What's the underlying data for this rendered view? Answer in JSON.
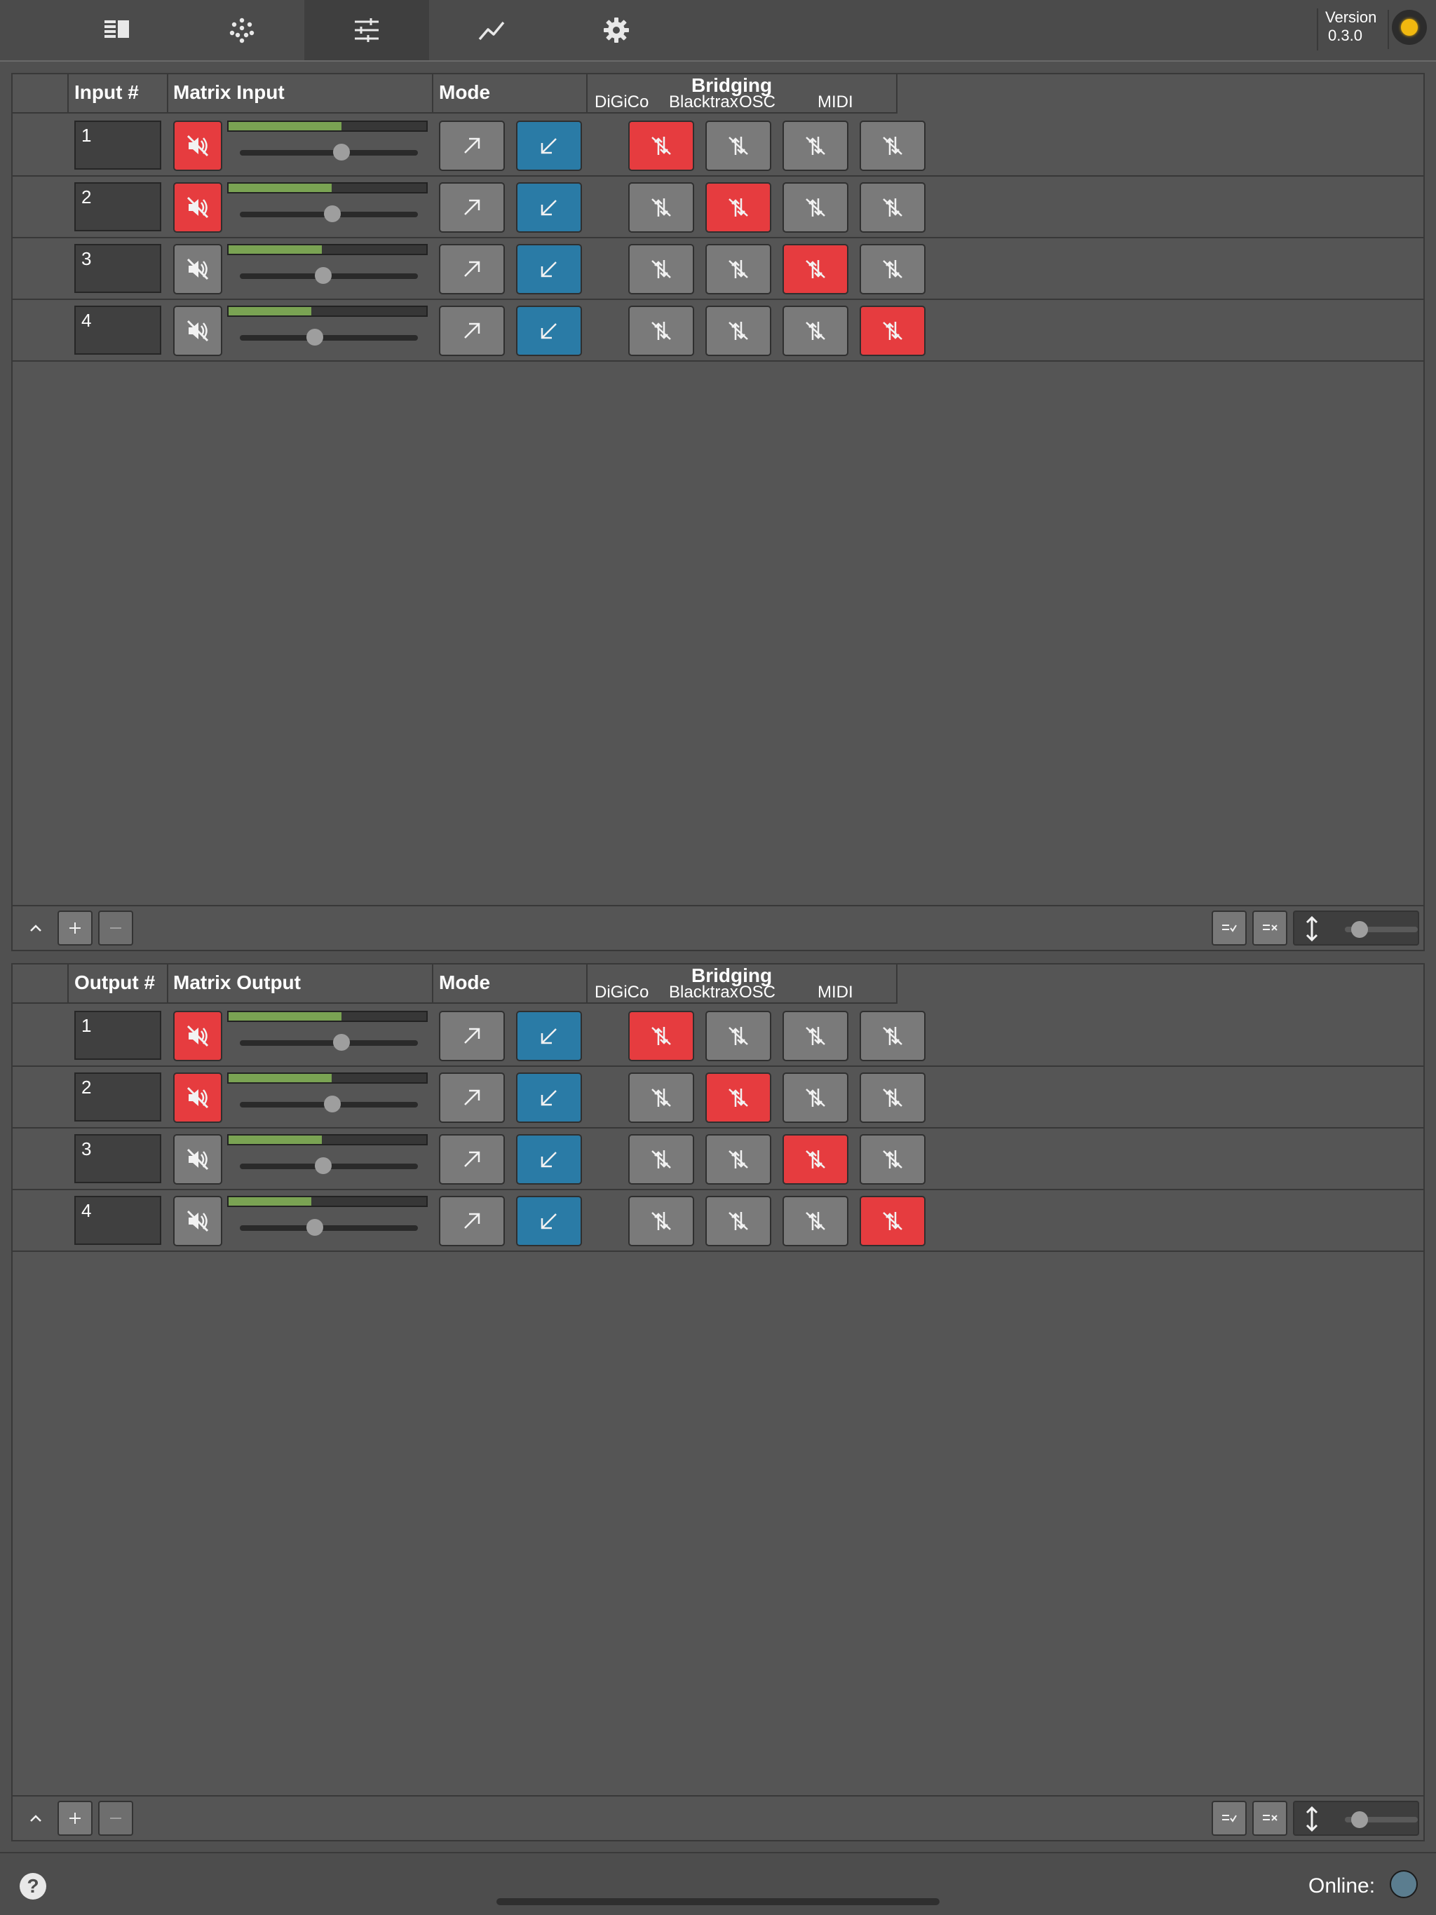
{
  "version": {
    "label": "Version",
    "number": "0.3.0"
  },
  "tabs": [
    {
      "name": "tab-sound-objects",
      "icon": "table-list-icon",
      "active": false
    },
    {
      "name": "tab-multislider",
      "icon": "dots-pattern-icon",
      "active": false
    },
    {
      "name": "tab-matrix-io",
      "icon": "sliders-icon",
      "active": true
    },
    {
      "name": "tab-statistics",
      "icon": "line-graph-icon",
      "active": false
    },
    {
      "name": "tab-settings",
      "icon": "gear-icon",
      "active": false
    }
  ],
  "bridging_labels": [
    "DiGiCo",
    "Blacktrax",
    "OSC",
    "MIDI"
  ],
  "panels": [
    {
      "id": "inputs",
      "num_header": "Input #",
      "name_header": "Matrix Input",
      "mode_header": "Mode",
      "bridging_title": "Bridging",
      "rows": [
        {
          "num": "1",
          "muted": true,
          "level": 0.57,
          "gain": 0.57,
          "bridging": [
            true,
            false,
            false,
            false
          ]
        },
        {
          "num": "2",
          "muted": true,
          "level": 0.52,
          "gain": 0.52,
          "bridging": [
            false,
            true,
            false,
            false
          ]
        },
        {
          "num": "3",
          "muted": false,
          "level": 0.47,
          "gain": 0.47,
          "bridging": [
            false,
            false,
            true,
            false
          ]
        },
        {
          "num": "4",
          "muted": false,
          "level": 0.42,
          "gain": 0.42,
          "bridging": [
            false,
            false,
            false,
            true
          ]
        }
      ],
      "footer": {
        "add_label": "+",
        "remove_label": "−",
        "row_height": 0.2
      }
    },
    {
      "id": "outputs",
      "num_header": "Output #",
      "name_header": "Matrix Output",
      "mode_header": "Mode",
      "bridging_title": "Bridging",
      "rows": [
        {
          "num": "1",
          "muted": true,
          "level": 0.57,
          "gain": 0.57,
          "bridging": [
            true,
            false,
            false,
            false
          ]
        },
        {
          "num": "2",
          "muted": true,
          "level": 0.52,
          "gain": 0.52,
          "bridging": [
            false,
            true,
            false,
            false
          ]
        },
        {
          "num": "3",
          "muted": false,
          "level": 0.47,
          "gain": 0.47,
          "bridging": [
            false,
            false,
            true,
            false
          ]
        },
        {
          "num": "4",
          "muted": false,
          "level": 0.42,
          "gain": 0.42,
          "bridging": [
            false,
            false,
            false,
            true
          ]
        }
      ],
      "footer": {
        "add_label": "+",
        "remove_label": "−",
        "row_height": 0.2
      }
    }
  ],
  "status": {
    "help_label": "?",
    "online_label": "Online:"
  },
  "colors": {
    "active_red": "#e63c3f",
    "mode_blue": "#2a7ba6",
    "meter_green": "#7aa353",
    "led_yellow": "#f1b80f",
    "online_led": "#5b7d8f"
  }
}
